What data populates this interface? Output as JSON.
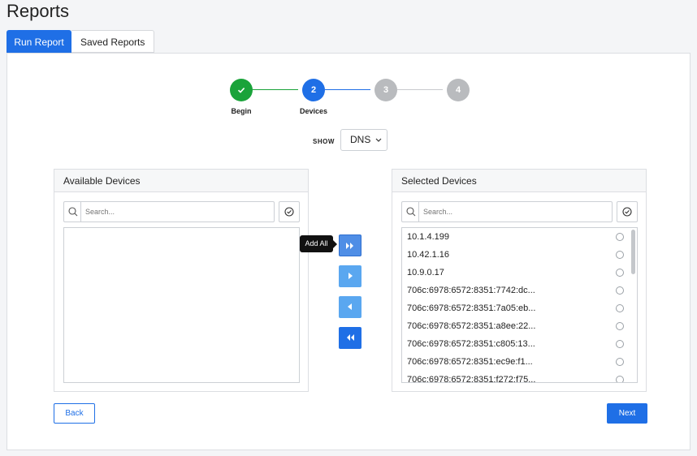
{
  "page": {
    "title": "Reports"
  },
  "tabs": [
    {
      "label": "Run Report",
      "active": true
    },
    {
      "label": "Saved Reports",
      "active": false
    }
  ],
  "stepper": {
    "steps": [
      {
        "number": "",
        "label": "Begin",
        "state": "done",
        "icon": "check-icon"
      },
      {
        "number": "2",
        "label": "Devices",
        "state": "current"
      },
      {
        "number": "3",
        "label": "",
        "state": "todo"
      },
      {
        "number": "4",
        "label": "",
        "state": "todo"
      }
    ]
  },
  "show": {
    "label": "SHOW",
    "value": "DNS"
  },
  "available": {
    "title": "Available Devices",
    "search_placeholder": "Search...",
    "items": []
  },
  "selected": {
    "title": "Selected Devices",
    "search_placeholder": "Search...",
    "items": [
      "10.1.4.199",
      "10.42.1.16",
      "10.9.0.17",
      "706c:6978:6572:8351:7742:dc...",
      "706c:6978:6572:8351:7a05:eb...",
      "706c:6978:6572:8351:a8ee:22...",
      "706c:6978:6572:8351:c805:13...",
      "706c:6978:6572:8351:ec9e:f1...",
      "706c:6978:6572:8351:f272:f75..."
    ]
  },
  "transfer": {
    "tooltip": "Add All"
  },
  "footer": {
    "back_label": "Back",
    "next_label": "Next"
  },
  "colors": {
    "primary": "#1f6fe6",
    "success": "#1aa33a",
    "inactive_step": "#b9bbbe",
    "transfer_light": "#5aa7f0"
  }
}
